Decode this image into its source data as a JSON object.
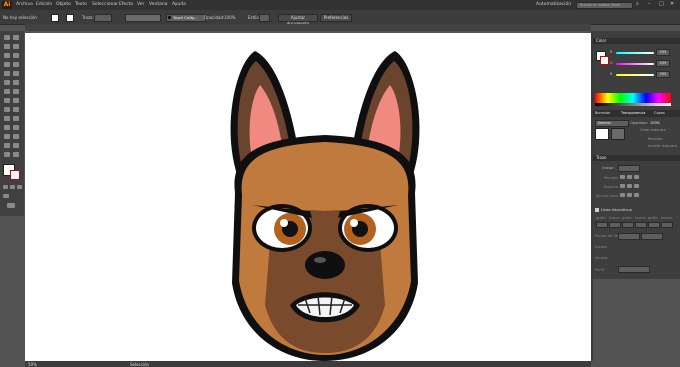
{
  "app": {
    "logo": "Ai"
  },
  "menu": [
    "Archivo",
    "Edición",
    "Objeto",
    "Texto",
    "Seleccionar",
    "Efecto",
    "Ver",
    "Ventana",
    "Ayuda"
  ],
  "workspace": {
    "label": "Automatización",
    "search_placeholder": "Buscar en Adobe Stock"
  },
  "control": {
    "selection_label": "No hay selección",
    "stroke_label": "Trazo:",
    "brush": "Touch Callig...",
    "opacity_label": "Opacidad:",
    "opacity_value": "100%",
    "style_label": "Estilo:",
    "doc_button": "Ajustar documento",
    "prefs_button": "Preferencias"
  },
  "color_panel": {
    "title": "Color",
    "channels": [
      {
        "name": "R",
        "value": "255"
      },
      {
        "name": "G",
        "value": "255"
      },
      {
        "name": "B",
        "value": "255"
      }
    ]
  },
  "transparency_panel": {
    "tabs": [
      "Borrador",
      "Transparencia",
      "Capas"
    ],
    "mode": "Normal",
    "opacity_label": "Opacidad:",
    "opacity_value": "100%",
    "options": [
      "Crear máscara",
      "Recortar",
      "Invertir máscara"
    ]
  },
  "stroke_panel": {
    "title": "Trazo",
    "grosor_label": "Grosor:",
    "rows": [
      "Remate:",
      "Esquina:",
      "Alinear trazo:"
    ],
    "dashed_label": "Línea discontinua",
    "dash_labels": [
      "guión",
      "hueco",
      "guión",
      "hueco",
      "guión",
      "hueco"
    ],
    "arrow_rows": [
      "Puntas de flecha:",
      "Escala:",
      "Alinear:",
      "Perfil:"
    ]
  },
  "status": {
    "zoom": "50%",
    "tool": "Selección"
  },
  "colors": {
    "accent_orange": "#ff9a00",
    "artboard": "#ffffff",
    "fur": "#c07a3e",
    "eye_iris": "#b5621e"
  },
  "icons": [
    "ai-logo",
    "search-icon",
    "minimize-icon",
    "maximize-icon",
    "close-icon",
    "selection-tool-icon",
    "direct-selection-tool-icon",
    "pen-tool-icon",
    "type-tool-icon",
    "brush-tool-icon",
    "hand-tool-icon",
    "zoom-tool-icon",
    "fill-swatch-icon",
    "stroke-swatch-icon"
  ]
}
